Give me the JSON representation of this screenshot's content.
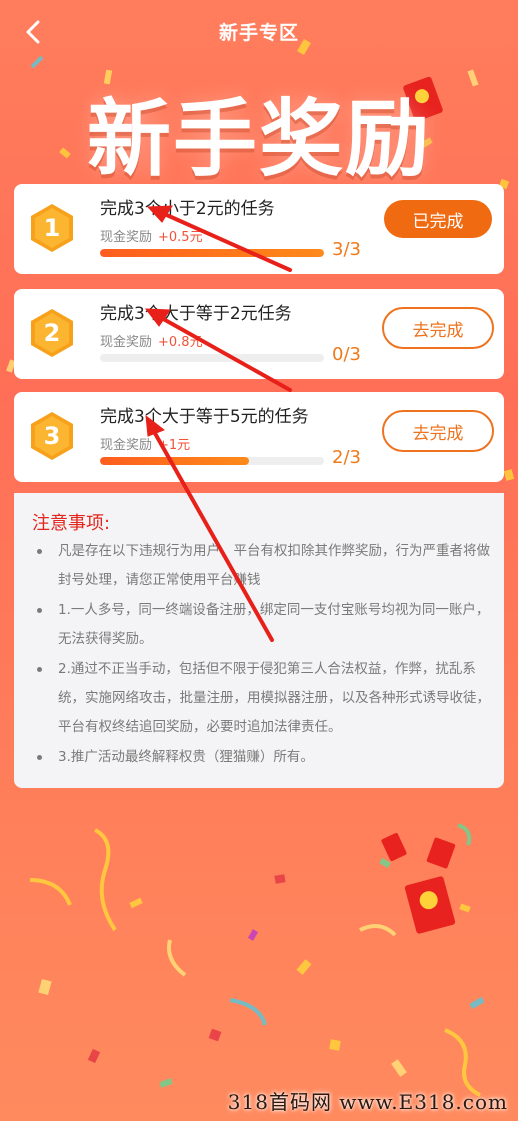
{
  "header": {
    "title": "新手专区"
  },
  "hero": {
    "title": "新手奖励"
  },
  "tasks": [
    {
      "number": "1",
      "title": "完成3个小于2元的任务",
      "reward_label": "现金奖励",
      "reward_amount": "+0.5元",
      "progress_text": "3/3",
      "progress_fraction": 1.0,
      "button_label": "已完成",
      "button_state": "done"
    },
    {
      "number": "2",
      "title": "完成3个大于等于2元任务",
      "reward_label": "现金奖励",
      "reward_amount": "+0.8元",
      "progress_text": "0/3",
      "progress_fraction": 0.0,
      "button_label": "去完成",
      "button_state": "todo"
    },
    {
      "number": "3",
      "title": "完成3个大于等于5元的任务",
      "reward_label": "现金奖励",
      "reward_amount": "+1元",
      "progress_text": "2/3",
      "progress_fraction": 0.6667,
      "button_label": "去完成",
      "button_state": "todo"
    }
  ],
  "notice": {
    "title": "注意事项:",
    "items": [
      "凡是存在以下违规行为用户，平台有权扣除其作弊奖励，行为严重者将做封号处理，请您正常使用平台赚钱",
      "1.一人多号，同一终端设备注册，绑定同一支付宝账号均视为同一账户，无法获得奖励。",
      "2.通过不正当手动，包括但不限于侵犯第三人合法权益，作弊，扰乱系统，实施网络攻击，批量注册，用模拟器注册，以及各种形式诱导收徒，平台有权终结追回奖励，必要时追加法律责任。",
      "3.推广活动最终解释权贵（狸猫赚）所有。"
    ]
  },
  "watermark": "318首码网 www.E318.com",
  "colors": {
    "background": "#ff7b5a",
    "accent": "#f06a12",
    "badge": "#f7a11b",
    "notice_title": "#e3261d",
    "annotation_arrow": "#e8201a"
  }
}
